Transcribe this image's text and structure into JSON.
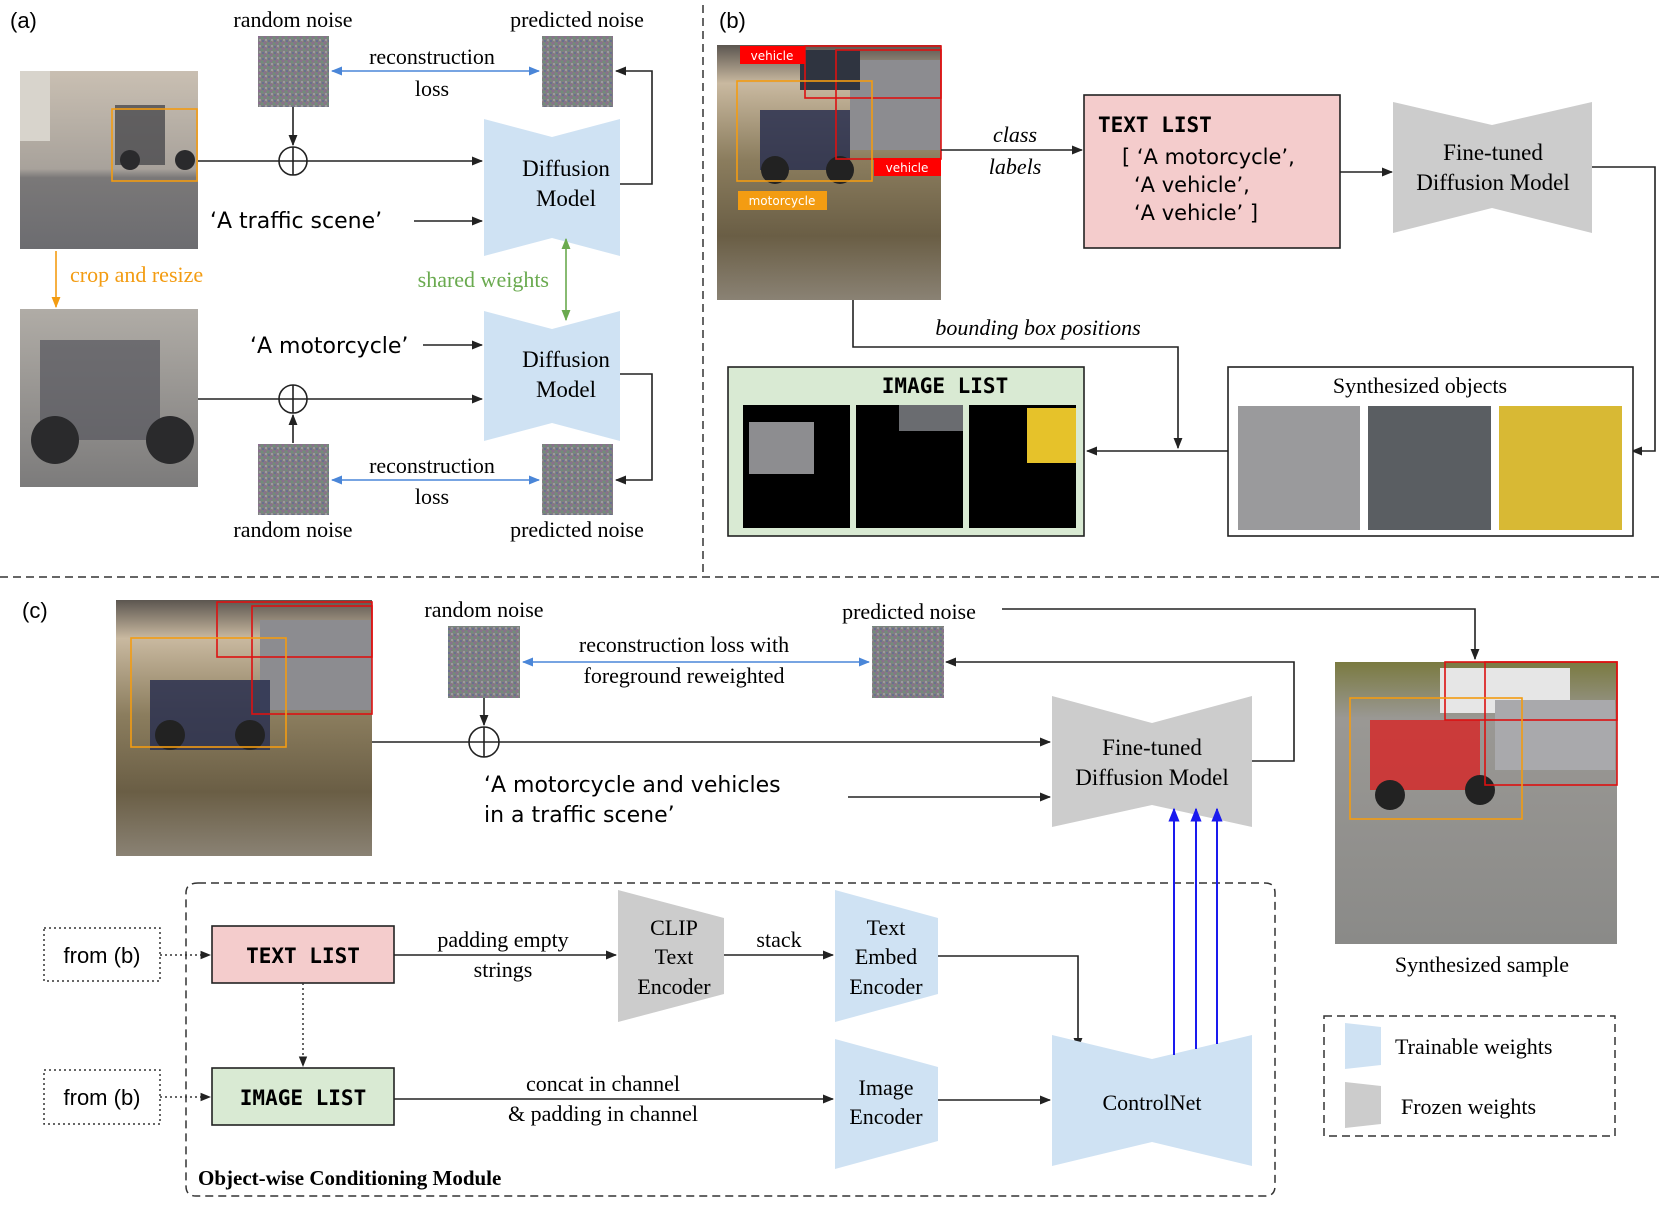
{
  "panels": {
    "a": {
      "label": "(a)",
      "top": {
        "random_noise": "random noise",
        "predicted_noise": "predicted noise",
        "loss_line1": "reconstruction",
        "loss_line2": "loss",
        "prompt": "‘A  traffic scene’",
        "model_line1": "Diffusion",
        "model_line2": "Model"
      },
      "crop_label": "crop and resize",
      "shared_label": "shared weights",
      "bottom": {
        "random_noise": "random noise",
        "predicted_noise": "predicted noise",
        "loss_line1": "reconstruction",
        "loss_line2": "loss",
        "prompt": "‘A  motorcycle’",
        "model_line1": "Diffusion",
        "model_line2": "Model"
      }
    },
    "b": {
      "label": "(b)",
      "bbox_labels": [
        "vehicle",
        "vehicle",
        "motorcycle"
      ],
      "class_labels_line1": "class",
      "class_labels_line2": "labels",
      "text_list": {
        "title": "TEXT LIST",
        "items": [
          "[ ‘A  motorcycle’,",
          "‘A  vehicle’,",
          "‘A  vehicle’ ]"
        ]
      },
      "model_line1": "Fine-tuned",
      "model_line2": "Diffusion Model",
      "bbox_positions": "bounding box positions",
      "image_list_title": "IMAGE LIST",
      "synth_objects_title": "Synthesized objects"
    },
    "c": {
      "label": "(c)",
      "random_noise": "random noise",
      "predicted_noise": "predicted noise",
      "loss_line1": "reconstruction loss with",
      "loss_line2": "foreground reweighted",
      "prompt_line1": "‘A  motorcycle  and  vehicles",
      "prompt_line2": "in  a  traffic  scene’",
      "model_line1": "Fine-tuned",
      "model_line2": "Diffusion Model",
      "synth_sample": "Synthesized sample",
      "from_b_1": "from (b)",
      "from_b_2": "from (b)",
      "text_list": "TEXT LIST",
      "image_list": "IMAGE LIST",
      "padding_line1": "padding empty",
      "padding_line2": "strings",
      "clip_line1": "CLIP",
      "clip_line2": "Text",
      "clip_line3": "Encoder",
      "stack": "stack",
      "text_embed_line1": "Text",
      "text_embed_line2": "Embed",
      "text_embed_line3": "Encoder",
      "concat_line1": "concat in channel",
      "concat_line2": "& padding in channel",
      "image_enc_line1": "Image",
      "image_enc_line2": "Encoder",
      "controlnet": "ControlNet",
      "module_title": "Object-wise Conditioning Module"
    }
  },
  "legend": {
    "trainable": "Trainable weights",
    "frozen": "Frozen weights"
  },
  "colors": {
    "trainable": "#cfe2f3",
    "frozen": "#cccccc",
    "text_list_bg": "#f4cccc",
    "image_list_bg": "#d9ead3",
    "orange_box": "#f39c12",
    "red_box": "#dd1111",
    "loss_arrow": "#4a86d8",
    "shared_arrow": "#6aaa4f",
    "control_arrow": "#1a1aee"
  }
}
